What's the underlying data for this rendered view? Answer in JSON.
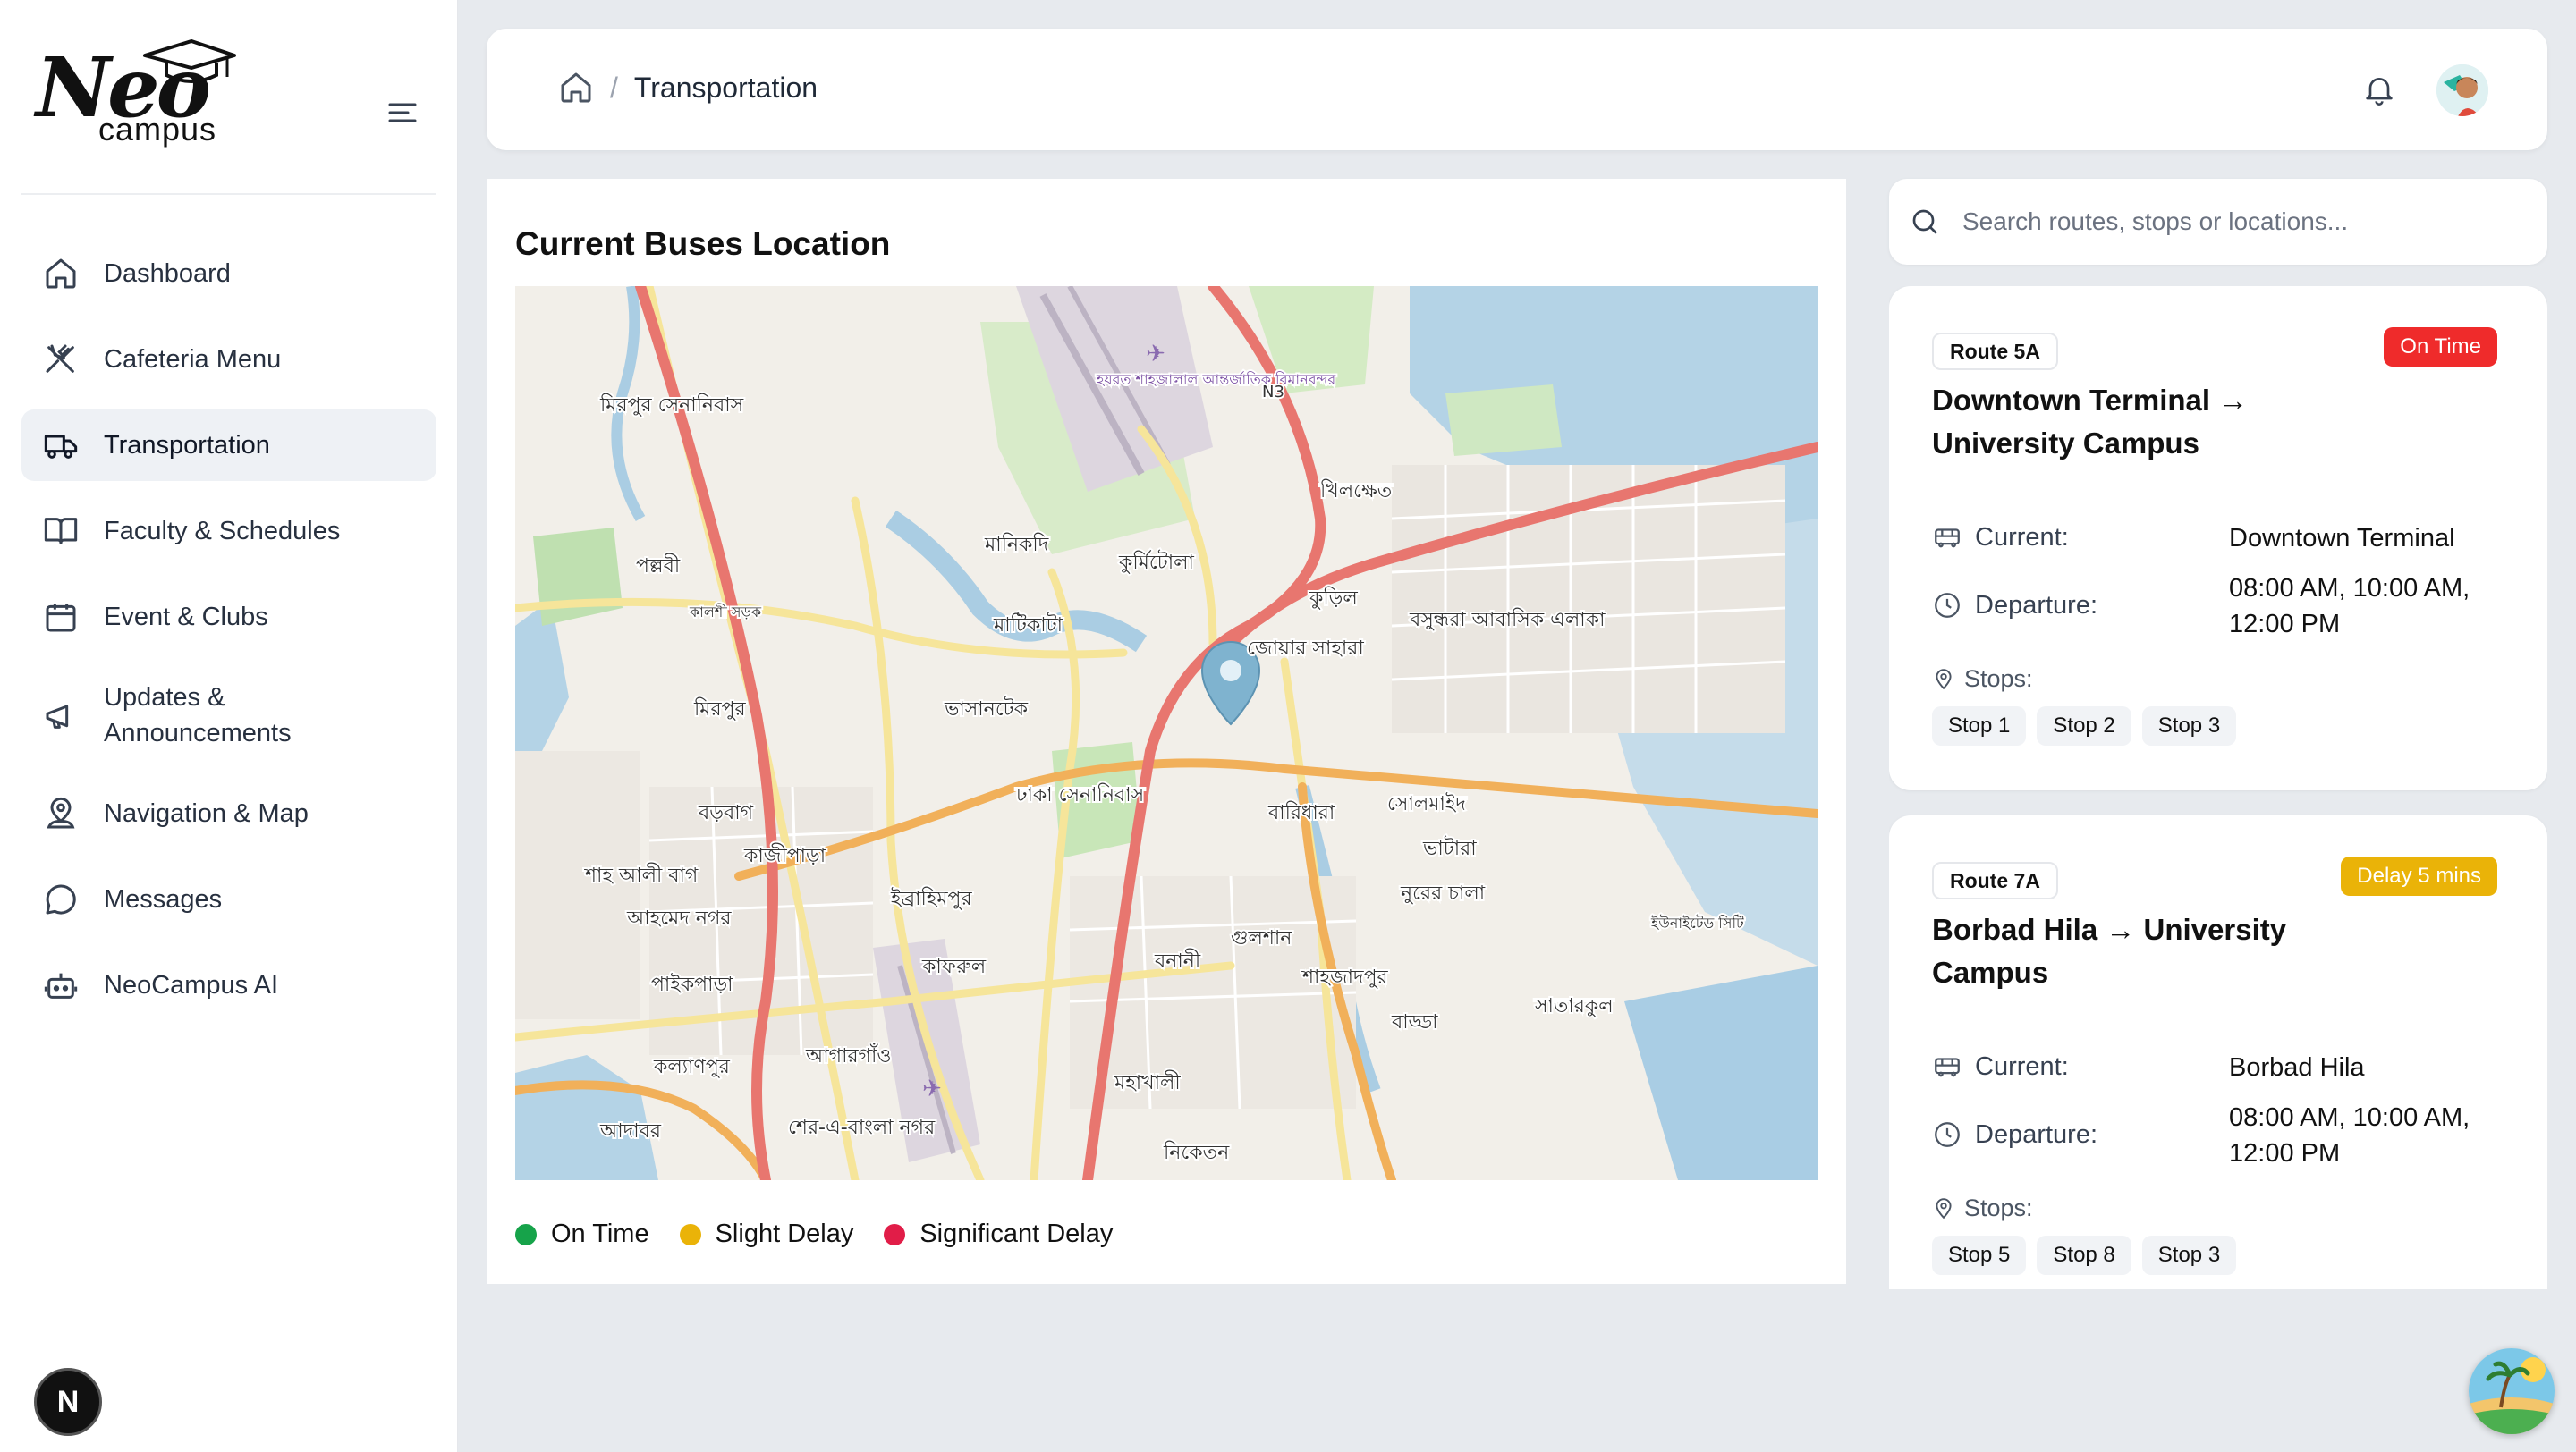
{
  "app": {
    "logo_word": "Neo",
    "logo_sub": "campus"
  },
  "sidebar": {
    "items": [
      {
        "label": "Dashboard",
        "icon": "home-icon"
      },
      {
        "label": "Cafeteria Menu",
        "icon": "utensils-icon"
      },
      {
        "label": "Transportation",
        "icon": "truck-icon",
        "active": true
      },
      {
        "label": "Faculty & Schedules",
        "icon": "book-open-icon"
      },
      {
        "label": "Event & Clubs",
        "icon": "calendar-icon"
      },
      {
        "label": "Updates & Announcements",
        "icon": "megaphone-icon"
      },
      {
        "label": "Navigation & Map",
        "icon": "map-pin-user-icon"
      },
      {
        "label": "Messages",
        "icon": "chat-icon"
      },
      {
        "label": "NeoCampus AI",
        "icon": "robot-icon"
      }
    ],
    "footer_badge": "N"
  },
  "header": {
    "breadcrumb_home_icon": "home-icon",
    "breadcrumb_sep": "/",
    "breadcrumb_current": "Transportation"
  },
  "map_panel": {
    "title": "Current Buses Location",
    "labels": [
      "মিরপুর সেনানিবাস",
      "হযরত শাহজালাল আন্তর্জাতিক বিমানবন্দর",
      "N3",
      "খিলক্ষেত",
      "পল্লবী",
      "মানিকদি",
      "কুর্মিটোলা",
      "কুড়িল",
      "বসুন্ধরা আবাসিক এলাকা",
      "মাটিকাটা",
      "জোয়ার সাহারা",
      "মিরপুর",
      "ভাসানটেক",
      "ঢাকা সেনানিবাস",
      "বারিধারা",
      "সোলমাইদ",
      "বড়বাগ",
      "কাজীপাড়া",
      "ভাটারা",
      "শাহ আলী বাগ",
      "আহমেদ নগর",
      "ইব্রাহিমপুর",
      "নুরের চালা",
      "গুলশান",
      "বনানী",
      "পাইকপাড়া",
      "কাফরুল",
      "শাহজাদপুর",
      "সাতারকুল",
      "বাড্ডা",
      "কল্যাণপুর",
      "আগারগাঁও",
      "মহাখালী",
      "আদাবর",
      "শের-এ-বাংলা নগর",
      "নিকেতন",
      "ইউনাইটেড সিটি",
      "কালশী সড়ক"
    ],
    "legend": [
      {
        "label": "On Time",
        "color": "#16a34a"
      },
      {
        "label": "Slight Delay",
        "color": "#eab308"
      },
      {
        "label": "Significant Delay",
        "color": "#e11d48"
      }
    ]
  },
  "search": {
    "placeholder": "Search routes, stops or locations..."
  },
  "routes": [
    {
      "route": "Route 5A",
      "status": "On Time",
      "status_color": "#ef2b2b",
      "title": "Downtown Terminal → University Campus",
      "current_label": "Current:",
      "current_value": "Downtown Terminal",
      "departure_label": "Departure:",
      "departure_value": "08:00 AM, 10:00 AM, 12:00 PM",
      "stops_label": "Stops:",
      "stops": [
        "Stop 1",
        "Stop 2",
        "Stop 3"
      ]
    },
    {
      "route": "Route 7A",
      "status": "Delay 5 mins",
      "status_color": "#eab308",
      "title": "Borbad Hila → University Campus",
      "current_label": "Current:",
      "current_value": "Borbad Hila",
      "departure_label": "Departure:",
      "departure_value": "08:00 AM, 10:00 AM, 12:00 PM",
      "stops_label": "Stops:",
      "stops": [
        "Stop 5",
        "Stop 8",
        "Stop 3"
      ]
    }
  ]
}
